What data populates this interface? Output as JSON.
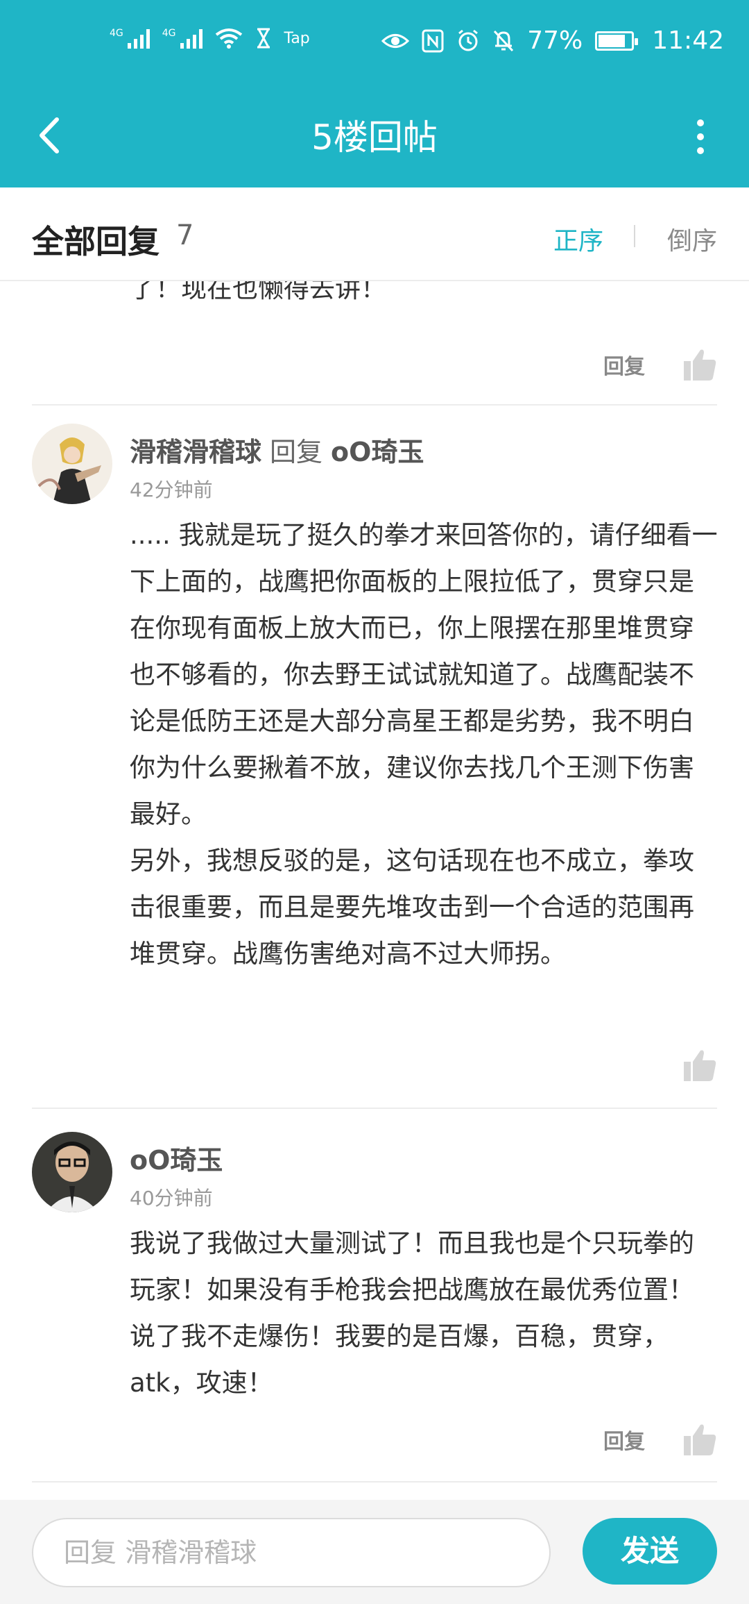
{
  "status_bar": {
    "carrier1": "4G",
    "carrier2": "4G",
    "app_badge": "Tap",
    "battery_percent": "77%",
    "time": "11:42"
  },
  "nav": {
    "title": "5楼回帖"
  },
  "section": {
    "title": "全部回复",
    "count": "7",
    "sort_asc": "正序",
    "sort_desc": "倒序"
  },
  "partial_comment": {
    "text_tail": "了！现在也懒得去讲！",
    "reply_label": "回复"
  },
  "comments": [
    {
      "author": "滑稽滑稽球",
      "reply_word": "回复",
      "reply_target": "oO琦玉",
      "time": "42分钟前",
      "body_p1": "..... 我就是玩了挺久的拳才来回答你的，请仔细看一下上面的，战鹰把你面板的上限拉低了，贯穿只是在你现有面板上放大而已，你上限摆在那里堆贯穿也不够看的，你去野王试试就知道了。战鹰配装不论是低防王还是大部分高星王都是劣势，我不明白你为什么要揪着不放，建议你去找几个王测下伤害最好。",
      "body_p2": "另外，我想反驳的是，这句话现在也不成立，拳攻击很重要，而且是要先堆攻击到一个合适的范围再堆贯穿。战鹰伤害绝对高不过大师拐。"
    },
    {
      "author": "oO琦玉",
      "time": "40分钟前",
      "body_p1": "我说了我做过大量测试了！而且我也是个只玩拳的玩家！如果没有手枪我会把战鹰放在最优秀位置！说了我不走爆伤！我要的是百爆，百稳，贯穿，atk，攻速！",
      "reply_label": "回复"
    }
  ],
  "input": {
    "placeholder": "回复 滑稽滑稽球",
    "send_label": "发送"
  },
  "colors": {
    "accent": "#1fb5c6"
  }
}
